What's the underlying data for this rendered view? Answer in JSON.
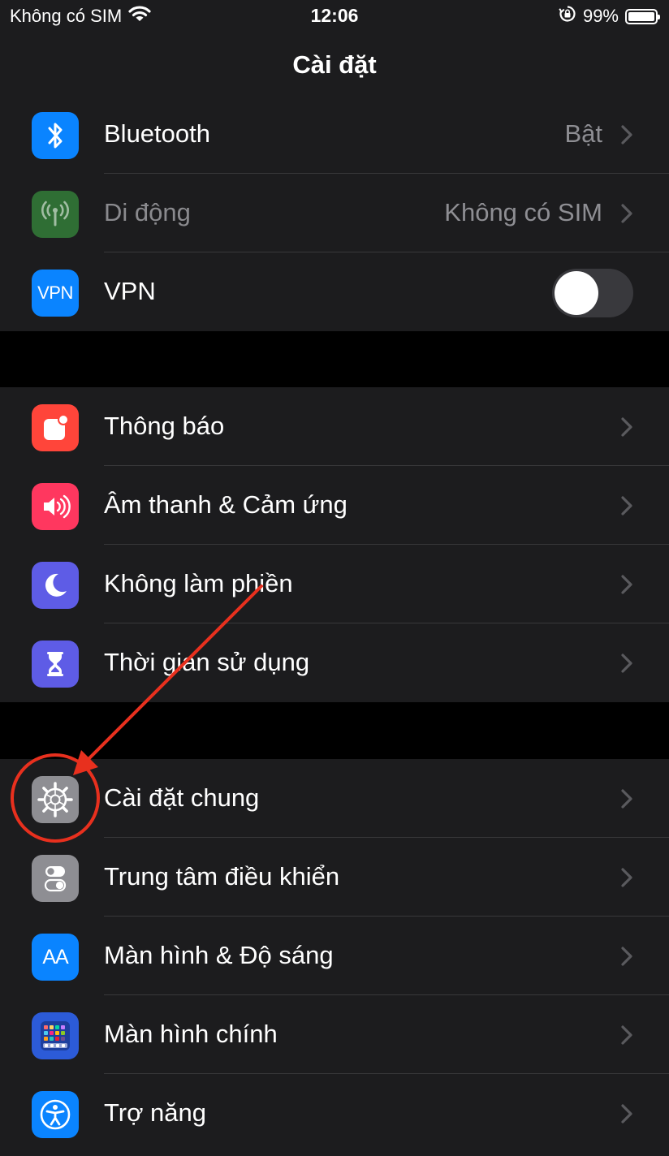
{
  "status_bar": {
    "carrier": "Không có SIM",
    "time": "12:06",
    "battery": "99%",
    "battery_level": 0.99
  },
  "nav": {
    "title": "Cài đặt"
  },
  "groups": [
    {
      "rows": [
        {
          "label": "Bluetooth",
          "value": "Bật",
          "icon": "bluetooth-icon",
          "color": "#0a84ff"
        },
        {
          "label": "Di động",
          "value": "Không có SIM",
          "icon": "cellular-icon",
          "color": "#2f6e34"
        },
        {
          "label": "VPN",
          "icon": "vpn-icon",
          "icon_text": "VPN",
          "color": "#0a84ff",
          "toggle": "off"
        }
      ]
    },
    {
      "rows": [
        {
          "label": "Thông báo",
          "icon": "notifications-icon",
          "color": "#ff453a"
        },
        {
          "label": "Âm thanh & Cảm ứng",
          "icon": "sounds-icon",
          "color": "#ff375f"
        },
        {
          "label": "Không làm phiền",
          "icon": "moon-icon",
          "color": "#5e5ce6"
        },
        {
          "label": "Thời gian sử dụng",
          "icon": "hourglass-icon",
          "color": "#5e5ce6"
        }
      ]
    },
    {
      "rows": [
        {
          "label": "Cài đặt chung",
          "icon": "gear-icon",
          "color": "#8e8e93"
        },
        {
          "label": "Trung tâm điều khiển",
          "icon": "control-center-icon",
          "color": "#8e8e93"
        },
        {
          "label": "Màn hình & Độ sáng",
          "icon": "display-brightness-icon",
          "icon_text": "AA",
          "color": "#0a84ff"
        },
        {
          "label": "Màn hình chính",
          "icon": "home-screen-icon",
          "color": "#2c5bd8"
        },
        {
          "label": "Trợ năng",
          "icon": "accessibility-icon",
          "color": "#0a84ff"
        }
      ]
    }
  ],
  "annotation_color": "#e8301e"
}
